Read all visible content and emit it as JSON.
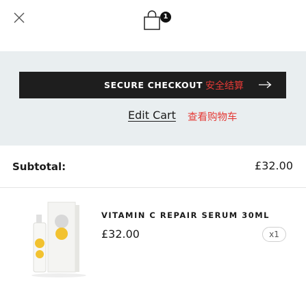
{
  "header": {
    "close_icon": "close-icon",
    "bag_icon": "shopping-bag-icon",
    "bag_count": "1"
  },
  "actions": {
    "checkout_label": "SECURE CHECKOUT",
    "checkout_label_cn": "安全结算",
    "checkout_arrow_icon": "arrow-right-icon",
    "edit_cart_label": "Edit Cart",
    "edit_cart_label_cn": "查看购物车"
  },
  "summary": {
    "subtotal_label": "Subtotal:",
    "subtotal_value": "£32.00"
  },
  "items": [
    {
      "name": "VITAMIN C REPAIR SERUM 30ML",
      "price": "£32.00",
      "quantity": "x1"
    }
  ],
  "colors": {
    "accent_red": "#e53935",
    "button_dark": "#1e1e1e",
    "panel_bg": "#e9eef0",
    "product_yellow": "#f2c230"
  }
}
